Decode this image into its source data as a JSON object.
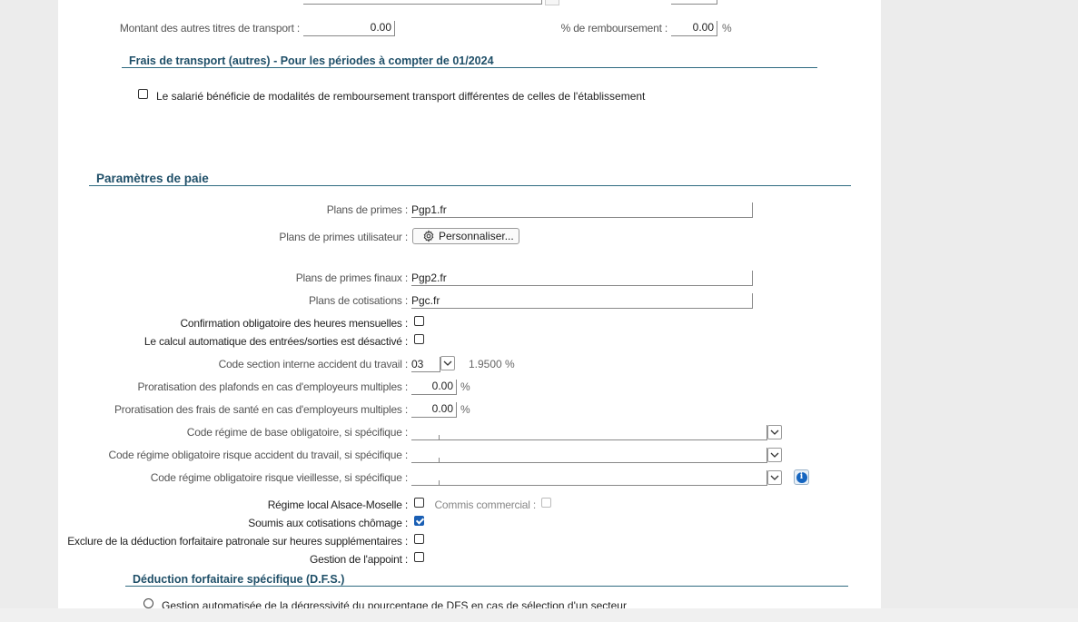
{
  "transport": {
    "montant_autres_label": "Montant des autres titres de transport :",
    "montant_autres_value": "0.00",
    "pct_remb_label": "% de remboursement :",
    "pct_remb_value": "0.00",
    "pct_unit": "%"
  },
  "frais_transport_autres": {
    "title": "Frais de transport (autres) - Pour les périodes à compter de 01/2024",
    "checkbox_label": "Le salarié bénéficie de modalités de remboursement transport différentes de celles de l'établissement",
    "checked": false
  },
  "parametres_paie": {
    "title": "Paramètres de paie",
    "plans_primes_label": "Plans de primes :",
    "plans_primes_value": "Pgp1.fr",
    "plans_primes_utilisateur_label": "Plans de primes utilisateur :",
    "personnaliser_label": "Personnaliser...",
    "plans_primes_finaux_label": "Plans de primes finaux :",
    "plans_primes_finaux_value": "Pgp2.fr",
    "plans_cotisations_label": "Plans de cotisations :",
    "plans_cotisations_value": "Pgc.fr",
    "confirmation_heures_label": "Confirmation obligatoire des heures mensuelles :",
    "confirmation_heures_checked": false,
    "calcul_auto_label": "Le calcul automatique des entrées/sorties est désactivé :",
    "calcul_auto_checked": false,
    "code_section_label": "Code section interne accident du travail :",
    "code_section_value": "03",
    "code_section_rate": "1.9500 %",
    "proratisation_plafonds_label": "Proratisation des plafonds en cas d'employeurs multiples :",
    "proratisation_plafonds_value": "0.00",
    "proratisation_sante_label": "Proratisation des frais de santé en cas d'employeurs multiples :",
    "proratisation_sante_value": "0.00",
    "pct_unit": "%",
    "code_regime_base_label": "Code régime de base obligatoire, si spécifique :",
    "code_regime_base_value": "",
    "code_regime_at_label": "Code régime obligatoire risque accident du travail, si spécifique :",
    "code_regime_at_value": "",
    "code_regime_vieillesse_label": "Code régime obligatoire risque vieillesse, si spécifique :",
    "code_regime_vieillesse_value": "",
    "regime_local_label": "Régime local Alsace-Moselle :",
    "regime_local_checked": false,
    "commis_commercial_label": "Commis commercial :",
    "commis_commercial_checked": false,
    "soumis_chomage_label": "Soumis aux cotisations chômage :",
    "soumis_chomage_checked": true,
    "exclure_deduction_label": "Exclure de la déduction forfaitaire patronale sur heures supplémentaires :",
    "exclure_deduction_checked": false,
    "gestion_appoint_label": "Gestion de l'appoint :",
    "gestion_appoint_checked": false
  },
  "dfs": {
    "title": "Déduction forfaitaire spécifique (D.F.S.)",
    "radio_label": "Gestion automatisée de la dégressivité du pourcentage de DFS en cas de sélection d'un secteur"
  },
  "colors": {
    "section_title": "#1f4f68",
    "section_line": "#2e6a80",
    "checked_box": "#1a5fb4",
    "info_icon": "#1565c0"
  }
}
